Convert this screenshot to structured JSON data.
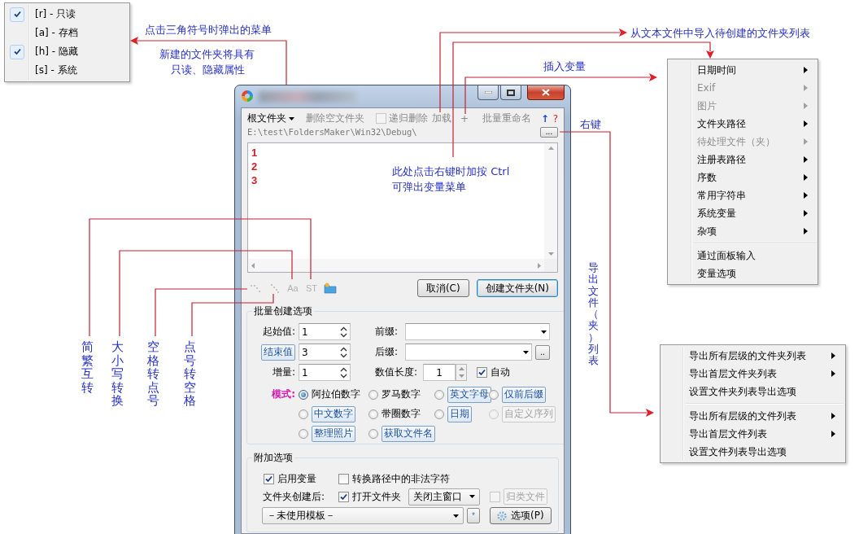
{
  "attribute_menu": {
    "items": [
      {
        "label": "[r] - 只读",
        "checked": true
      },
      {
        "label": "[a] - 存档",
        "checked": false
      },
      {
        "label": "[h] - 隐藏",
        "checked": true
      },
      {
        "label": "[s] - 系统",
        "checked": false
      }
    ]
  },
  "annotations": [
    "点击三角符号时弹出的菜单",
    "新建的文件夹将具有",
    "只读、隐藏属性",
    "从文本文件中导入待创建的文件夹列表",
    "插入变量",
    "右键",
    "此处点击右键时加按 Ctrl",
    "可弹出变量菜单"
  ],
  "vertical_annotations": [
    "简繁互转",
    "大小写转换",
    "空格转点号",
    "点号转空格",
    "导出文件（夹）列表"
  ],
  "window": {
    "toolbar": [
      {
        "kind": "menu",
        "label": "根文件夹",
        "disabled": false
      },
      {
        "kind": "button",
        "label": "删除空文件夹",
        "disabled": true
      },
      {
        "kind": "checkbox",
        "label": "递归删除",
        "checked": false,
        "disabled": true
      },
      {
        "kind": "button",
        "label": "加载",
        "disabled": true
      },
      {
        "kind": "button",
        "label": "+",
        "disabled": true
      },
      {
        "kind": "button",
        "label": "批量重命名",
        "disabled": true
      },
      {
        "kind": "arrow",
        "label": "↑"
      },
      {
        "kind": "help",
        "label": "?"
      }
    ],
    "path": "E:\\test\\FoldersMaker\\Win32\\Debug\\",
    "browse_button": "...",
    "lines": [
      "1",
      "2",
      "3"
    ],
    "tool_icons": [
      {
        "kind": "dots"
      },
      {
        "kind": "dots"
      },
      {
        "kind": "glyph",
        "label": "Aa"
      },
      {
        "kind": "glyph",
        "label": "ST"
      },
      {
        "kind": "folder"
      }
    ],
    "buttons": [
      {
        "label": "取消(C)",
        "default": false
      },
      {
        "label": "创建文件夹(N)",
        "default": true
      }
    ],
    "batch_group": {
      "title": "批量创建选项",
      "start": {
        "label": "起始值:",
        "value": "1"
      },
      "end": {
        "label": "结束值",
        "value": "3"
      },
      "step": {
        "label": "增量:",
        "value": "1"
      },
      "prefix": {
        "label": "前缀:"
      },
      "suffix": {
        "label": "后缀:"
      },
      "suffix_button": "..",
      "digits": {
        "label": "数值长度:",
        "value": "1"
      },
      "auto": {
        "label": "自动",
        "checked": true
      },
      "mode_label": "模式:",
      "modes": [
        {
          "label": "阿拉伯数字",
          "kind": "text",
          "selected": true,
          "disabled": false
        },
        {
          "label": "罗马数字",
          "kind": "text",
          "selected": false,
          "disabled": false
        },
        {
          "label": "英文字母",
          "kind": "button",
          "selected": false,
          "disabled": false
        },
        {
          "label": "仅前后缀",
          "kind": "button",
          "selected": false,
          "disabled": false
        },
        {
          "label": "中文数字",
          "kind": "button",
          "selected": false,
          "disabled": false
        },
        {
          "label": "带圈数字",
          "kind": "text",
          "selected": false,
          "disabled": false
        },
        {
          "label": "日期",
          "kind": "button",
          "selected": false,
          "disabled": false
        },
        {
          "label": "自定义序列",
          "kind": "button",
          "selected": false,
          "disabled": true
        },
        {
          "label": "整理照片",
          "kind": "button",
          "selected": false,
          "disabled": false
        },
        {
          "label": "获取文件名",
          "kind": "button",
          "selected": false,
          "disabled": false
        }
      ]
    },
    "extra_group": {
      "title": "附加选项",
      "enable_vars": {
        "label": "启用变量",
        "checked": true
      },
      "convert_illegal": {
        "label": "转换路径中的非法字符",
        "checked": false
      },
      "after_label": "文件夹创建后:",
      "open_folder": {
        "label": "打开文件夹",
        "checked": true
      },
      "after_action": "关闭主窗口",
      "classify": {
        "label": "归类文件",
        "checked": false,
        "disabled": true
      },
      "template": "－未使用模板－",
      "star_button": "*",
      "options_button": "选项(P)"
    }
  },
  "variable_menu": {
    "groups": [
      [
        {
          "label": "日期时间",
          "disabled": false,
          "submenu": true
        },
        {
          "label": "Exif",
          "disabled": true,
          "submenu": true
        },
        {
          "label": "图片",
          "disabled": true,
          "submenu": true
        },
        {
          "label": "文件夹路径",
          "disabled": false,
          "submenu": true
        },
        {
          "label": "待处理文件（夹）",
          "disabled": true,
          "submenu": true
        },
        {
          "label": "注册表路径",
          "disabled": false,
          "submenu": true
        },
        {
          "label": "序数",
          "disabled": false,
          "submenu": true
        },
        {
          "label": "常用字符串",
          "disabled": false,
          "submenu": true
        },
        {
          "label": "系统变量",
          "disabled": false,
          "submenu": true
        },
        {
          "label": "杂项",
          "disabled": false,
          "submenu": true
        }
      ],
      [
        {
          "label": "通过面板输入",
          "disabled": false,
          "submenu": false
        },
        {
          "label": "变量选项",
          "disabled": false,
          "submenu": false
        }
      ]
    ]
  },
  "export_menu": {
    "groups": [
      [
        {
          "label": "导出所有层级的文件夹列表",
          "disabled": false,
          "submenu": true
        },
        {
          "label": "导出首层文件夹列表",
          "disabled": false,
          "submenu": true
        },
        {
          "label": "设置文件夹列表导出选项",
          "disabled": false,
          "submenu": false
        }
      ],
      [
        {
          "label": "导出所有层级的文件列表",
          "disabled": false,
          "submenu": true
        },
        {
          "label": "导出首层文件列表",
          "disabled": false,
          "submenu": true
        },
        {
          "label": "设置文件列表导出选项",
          "disabled": false,
          "submenu": false
        }
      ]
    ]
  }
}
